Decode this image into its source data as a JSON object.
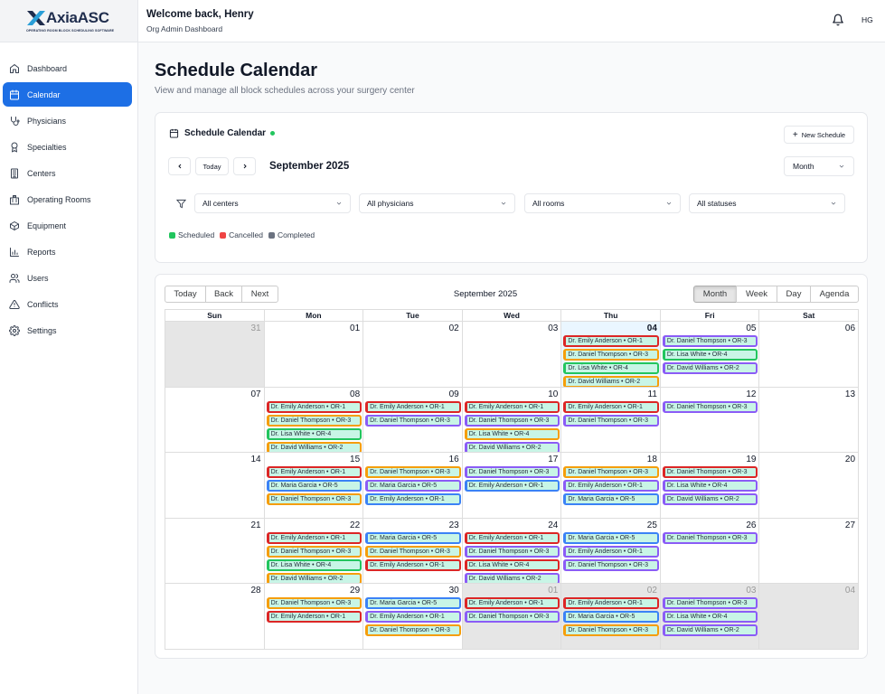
{
  "app": {
    "brand": "AxiaASC",
    "tagline": "OPERATING ROOM BLOCK SCHEDULING SOFTWARE"
  },
  "header": {
    "welcome": "Welcome back, Henry",
    "subtitle": "Org Admin Dashboard",
    "initials": "HG"
  },
  "sidebar": {
    "items": [
      {
        "label": "Dashboard",
        "icon": "home-icon"
      },
      {
        "label": "Calendar",
        "icon": "calendar-icon",
        "active": true
      },
      {
        "label": "Physicians",
        "icon": "stethoscope-icon"
      },
      {
        "label": "Specialties",
        "icon": "ribbon-icon"
      },
      {
        "label": "Centers",
        "icon": "building-icon"
      },
      {
        "label": "Operating Rooms",
        "icon": "hospital-icon"
      },
      {
        "label": "Equipment",
        "icon": "package-icon"
      },
      {
        "label": "Reports",
        "icon": "bar-chart-icon"
      },
      {
        "label": "Users",
        "icon": "users-icon"
      },
      {
        "label": "Conflicts",
        "icon": "warning-icon"
      },
      {
        "label": "Settings",
        "icon": "gear-icon"
      }
    ]
  },
  "page": {
    "title": "Schedule Calendar",
    "description": "View and manage all block schedules across your surgery center"
  },
  "panel": {
    "title": "Schedule Calendar",
    "new_button": "New Schedule",
    "today": "Today",
    "month_label": "September 2025",
    "view": "Month",
    "filters": [
      "All centers",
      "All physicians",
      "All rooms",
      "All statuses"
    ],
    "legend": [
      {
        "label": "Scheduled",
        "color": "#22c55e"
      },
      {
        "label": "Cancelled",
        "color": "#ef4444"
      },
      {
        "label": "Completed",
        "color": "#6b7280"
      }
    ]
  },
  "calendar": {
    "toolbar_left": [
      "Today",
      "Back",
      "Next"
    ],
    "label": "September 2025",
    "toolbar_right": [
      "Month",
      "Week",
      "Day",
      "Agenda"
    ],
    "days_of_week": [
      "Sun",
      "Mon",
      "Tue",
      "Wed",
      "Thu",
      "Fri",
      "Sat"
    ],
    "weeks": [
      [
        {
          "d": "31",
          "off": true
        },
        {
          "d": "01"
        },
        {
          "d": "02"
        },
        {
          "d": "03"
        },
        {
          "d": "04",
          "today": true,
          "ev": [
            [
              "Dr. Emily Anderson • OR-1",
              "r"
            ],
            [
              "Dr. Daniel Thompson • OR-3",
              "o"
            ],
            [
              "Dr. Lisa White • OR-4",
              "g"
            ],
            [
              "Dr. David Williams • OR-2",
              "o"
            ]
          ]
        },
        {
          "d": "05",
          "ev": [
            [
              "Dr. Daniel Thompson • OR-3",
              "p"
            ],
            [
              "Dr. Lisa White • OR-4",
              "g"
            ],
            [
              "Dr. David Williams • OR-2",
              "p"
            ]
          ]
        },
        {
          "d": "06"
        }
      ],
      [
        {
          "d": "07"
        },
        {
          "d": "08",
          "ev": [
            [
              "Dr. Emily Anderson • OR-1",
              "r"
            ],
            [
              "Dr. Daniel Thompson • OR-3",
              "o"
            ],
            [
              "Dr. Lisa White • OR-4",
              "g"
            ],
            [
              "Dr. David Williams • OR-2",
              "o"
            ]
          ]
        },
        {
          "d": "09",
          "ev": [
            [
              "Dr. Emily Anderson • OR-1",
              "r"
            ],
            [
              "Dr. Daniel Thompson • OR-3",
              "p"
            ]
          ]
        },
        {
          "d": "10",
          "ev": [
            [
              "Dr. Emily Anderson • OR-1",
              "r"
            ],
            [
              "Dr. Daniel Thompson • OR-3",
              "p"
            ],
            [
              "Dr. Lisa White • OR-4",
              "o"
            ],
            [
              "Dr. David Williams • OR-2",
              "p"
            ]
          ]
        },
        {
          "d": "11",
          "ev": [
            [
              "Dr. Emily Anderson • OR-1",
              "r"
            ],
            [
              "Dr. Daniel Thompson • OR-3",
              "p"
            ]
          ]
        },
        {
          "d": "12",
          "ev": [
            [
              "Dr. Daniel Thompson • OR-3",
              "p"
            ]
          ]
        },
        {
          "d": "13"
        }
      ],
      [
        {
          "d": "14"
        },
        {
          "d": "15",
          "ev": [
            [
              "Dr. Emily Anderson • OR-1",
              "r"
            ],
            [
              "Dr. Maria Garcia • OR-5",
              "b"
            ],
            [
              "Dr. Daniel Thompson • OR-3",
              "o"
            ]
          ]
        },
        {
          "d": "16",
          "ev": [
            [
              "Dr. Daniel Thompson • OR-3",
              "o"
            ],
            [
              "Dr. Maria Garcia • OR-5",
              "p"
            ],
            [
              "Dr. Emily Anderson • OR-1",
              "b"
            ]
          ]
        },
        {
          "d": "17",
          "ev": [
            [
              "Dr. Daniel Thompson • OR-3",
              "p"
            ],
            [
              "Dr. Emily Anderson • OR-1",
              "b"
            ]
          ]
        },
        {
          "d": "18",
          "ev": [
            [
              "Dr. Daniel Thompson • OR-3",
              "o"
            ],
            [
              "Dr. Emily Anderson • OR-1",
              "p"
            ],
            [
              "Dr. Maria Garcia • OR-5",
              "b"
            ]
          ]
        },
        {
          "d": "19",
          "ev": [
            [
              "Dr. Daniel Thompson • OR-3",
              "r"
            ],
            [
              "Dr. Lisa White • OR-4",
              "p"
            ],
            [
              "Dr. David Williams • OR-2",
              "p"
            ]
          ]
        },
        {
          "d": "20"
        }
      ],
      [
        {
          "d": "21"
        },
        {
          "d": "22",
          "ev": [
            [
              "Dr. Emily Anderson • OR-1",
              "r"
            ],
            [
              "Dr. Daniel Thompson • OR-3",
              "o"
            ],
            [
              "Dr. Lisa White • OR-4",
              "g"
            ],
            [
              "Dr. David Williams • OR-2",
              "o"
            ]
          ]
        },
        {
          "d": "23",
          "ev": [
            [
              "Dr. Maria Garcia • OR-5",
              "b"
            ],
            [
              "Dr. Daniel Thompson • OR-3",
              "o"
            ],
            [
              "Dr. Emily Anderson • OR-1",
              "r"
            ]
          ]
        },
        {
          "d": "24",
          "ev": [
            [
              "Dr. Emily Anderson • OR-1",
              "r"
            ],
            [
              "Dr. Daniel Thompson • OR-3",
              "p"
            ],
            [
              "Dr. Lisa White • OR-4",
              "r"
            ],
            [
              "Dr. David Williams • OR-2",
              "p"
            ]
          ]
        },
        {
          "d": "25",
          "ev": [
            [
              "Dr. Maria Garcia • OR-5",
              "b"
            ],
            [
              "Dr. Emily Anderson • OR-1",
              "p"
            ],
            [
              "Dr. Daniel Thompson • OR-3",
              "p"
            ]
          ]
        },
        {
          "d": "26",
          "ev": [
            [
              "Dr. Daniel Thompson • OR-3",
              "p"
            ]
          ]
        },
        {
          "d": "27"
        }
      ],
      [
        {
          "d": "28"
        },
        {
          "d": "29",
          "ev": [
            [
              "Dr. Daniel Thompson • OR-3",
              "o"
            ],
            [
              "Dr. Emily Anderson • OR-1",
              "r"
            ]
          ]
        },
        {
          "d": "30",
          "ev": [
            [
              "Dr. Maria Garcia • OR-5",
              "b"
            ],
            [
              "Dr. Emily Anderson • OR-1",
              "p"
            ],
            [
              "Dr. Daniel Thompson • OR-3",
              "o"
            ]
          ]
        },
        {
          "d": "01",
          "off": true,
          "ev": [
            [
              "Dr. Emily Anderson • OR-1",
              "r"
            ],
            [
              "Dr. Daniel Thompson • OR-3",
              "p"
            ]
          ]
        },
        {
          "d": "02",
          "off": true,
          "ev": [
            [
              "Dr. Emily Anderson • OR-1",
              "r"
            ],
            [
              "Dr. Maria Garcia • OR-5",
              "b"
            ],
            [
              "Dr. Daniel Thompson • OR-3",
              "o"
            ]
          ]
        },
        {
          "d": "03",
          "off": true,
          "ev": [
            [
              "Dr. Daniel Thompson • OR-3",
              "p"
            ],
            [
              "Dr. Lisa White • OR-4",
              "p"
            ],
            [
              "Dr. David Williams • OR-2",
              "p"
            ]
          ]
        },
        {
          "d": "04",
          "off": true
        }
      ]
    ]
  },
  "colors": {
    "accent": "#1d6fe5",
    "event_bg": "#c8f5e6",
    "r": "#dc2626",
    "o": "#f59e0b",
    "g": "#22c55e",
    "p": "#8b5cf6",
    "b": "#3b82f6"
  }
}
